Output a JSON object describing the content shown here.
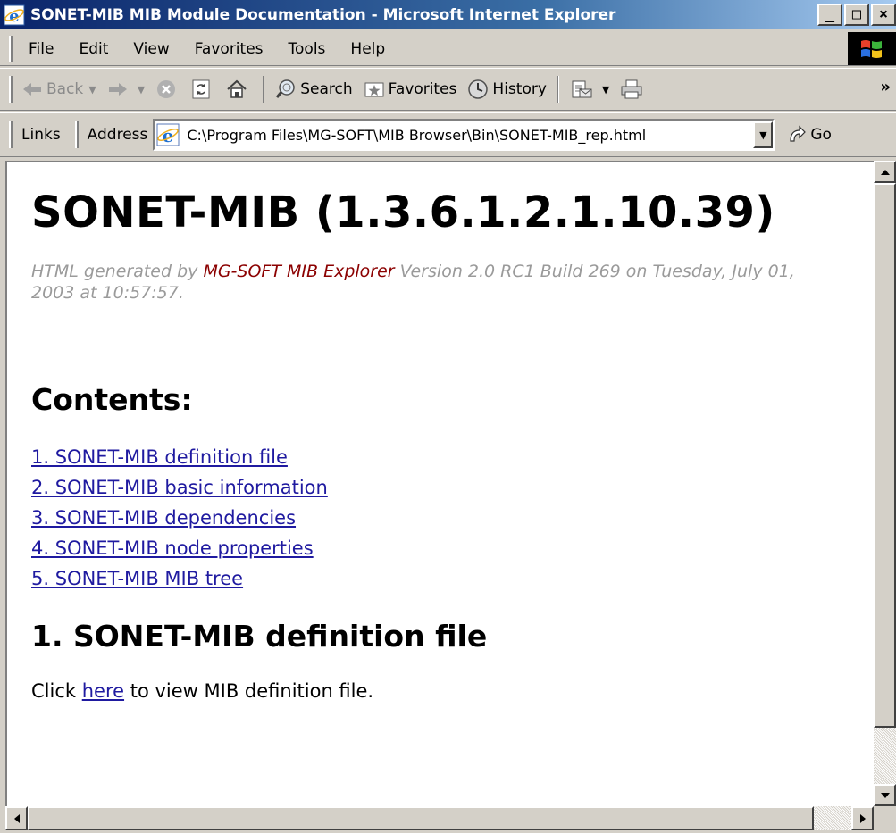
{
  "window": {
    "title": "SONET-MIB MIB Module Documentation - Microsoft Internet Explorer",
    "minimize": "_",
    "maximize": "□",
    "close": "×"
  },
  "menubar": {
    "items": [
      "File",
      "Edit",
      "View",
      "Favorites",
      "Tools",
      "Help"
    ]
  },
  "toolbar": {
    "back_label": "Back",
    "search_label": "Search",
    "favorites_label": "Favorites",
    "history_label": "History",
    "more": "»"
  },
  "addressbar": {
    "links_label": "Links",
    "address_label": "Address",
    "url": "C:\\Program Files\\MG-SOFT\\MIB Browser\\Bin\\SONET-MIB_rep.html",
    "go_label": "Go"
  },
  "page": {
    "title": "SONET-MIB (1.3.6.1.2.1.10.39)",
    "generated_prefix": "HTML generated by ",
    "generated_product": "MG-SOFT MIB Explorer",
    "generated_suffix": " Version 2.0 RC1 Build 269 on Tuesday, July 01, 2003 at 10:57:57.",
    "contents_heading": "Contents:",
    "toc": [
      "1. SONET-MIB definition file",
      "2. SONET-MIB basic information",
      "3. SONET-MIB dependencies",
      "4. SONET-MIB node properties",
      "5. SONET-MIB MIB tree"
    ],
    "section1_heading": "1. SONET-MIB definition file",
    "click_prefix": "Click ",
    "click_link": "here",
    "click_suffix": " to view MIB definition file."
  },
  "colors": {
    "titlebar_start": "#0a246a",
    "chrome": "#d4d0c8",
    "link": "#1f1aa0",
    "generated_text": "#9a9a9a",
    "product_text": "#8b0000"
  },
  "icons": [
    "ie-icon",
    "back-arrow-icon",
    "forward-arrow-icon",
    "stop-icon",
    "refresh-icon",
    "home-icon",
    "search-icon",
    "favorites-icon",
    "history-icon",
    "mail-icon",
    "print-icon",
    "go-arrow-icon",
    "windows-logo-icon"
  ]
}
